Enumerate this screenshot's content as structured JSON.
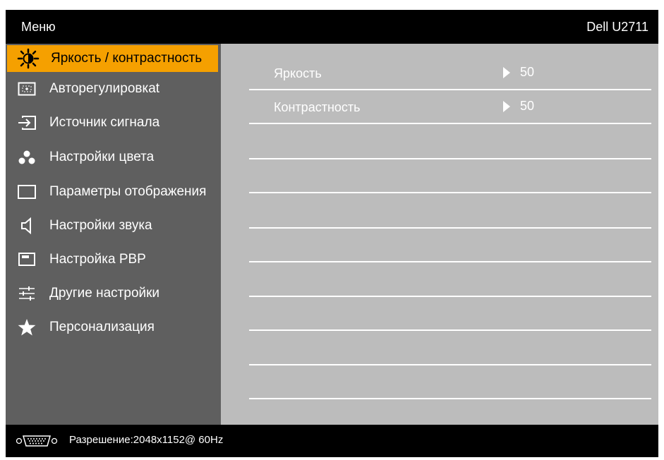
{
  "header": {
    "title": "Меню",
    "model": "Dell U2711"
  },
  "sidebar": {
    "items": [
      {
        "label": "Яркость / контрастность",
        "icon": "brightness-icon",
        "active": true
      },
      {
        "label": "Авторегулировкаt",
        "icon": "auto-adjust-icon",
        "active": false
      },
      {
        "label": "Источник сигнала",
        "icon": "input-source-icon",
        "active": false
      },
      {
        "label": "Настройки цвета",
        "icon": "color-dots-icon",
        "active": false
      },
      {
        "label": "Параметры отображения",
        "icon": "display-rectangle-icon",
        "active": false
      },
      {
        "label": "Настройки звука",
        "icon": "speaker-icon",
        "active": false
      },
      {
        "label": "Настройка PBP",
        "icon": "pbp-icon",
        "active": false
      },
      {
        "label": "Другие настройки",
        "icon": "sliders-icon",
        "active": false
      },
      {
        "label": "Персонализация",
        "icon": "star-icon",
        "active": false
      }
    ]
  },
  "content": {
    "params": [
      {
        "label": "Яркость",
        "value": "50"
      },
      {
        "label": "Контрастность",
        "value": "50"
      }
    ]
  },
  "footer": {
    "resolution": "Разрешение:2048x1152@ 60Hz",
    "icon": "vga-connector-icon"
  },
  "colors": {
    "highlight": "#f5a000",
    "sidebar_bg": "#5f5f5f",
    "content_bg": "#bcbcbc",
    "frame_bg": "#000000"
  }
}
